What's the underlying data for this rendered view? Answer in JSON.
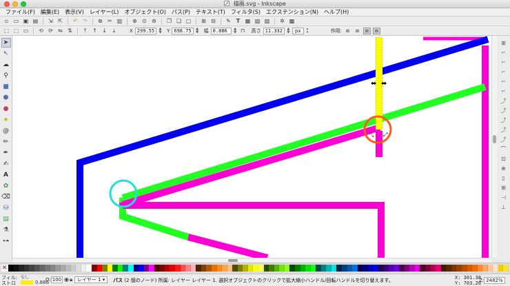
{
  "window": {
    "title": "描画.svg - Inkscape"
  },
  "menu": [
    {
      "label": "ファイル(F)"
    },
    {
      "label": "編集(E)"
    },
    {
      "label": "表示(V)"
    },
    {
      "label": "レイヤー(L)"
    },
    {
      "label": "オブジェクト(O)"
    },
    {
      "label": "パス(P)"
    },
    {
      "label": "テキスト(T)"
    },
    {
      "label": "フィルタ(S)"
    },
    {
      "label": "エクステンション(N)"
    },
    {
      "label": "ヘルプ(H)"
    }
  ],
  "controls": {
    "x_label": "X",
    "x_value": "299.55",
    "y_label": "Y",
    "y_value": "698.75",
    "w_label": "幅",
    "w_value": "0.886",
    "h_label": "高さ",
    "h_value": "11.332",
    "unit": "px",
    "affect_label": "作用:"
  },
  "status": {
    "fill_label": "フィル:",
    "stroke_label": "ストローク:",
    "fill_value": "なし",
    "stroke_width": "0.886",
    "opacity_label": "O:",
    "opacity_value": "100",
    "layer": "レイヤー 1",
    "message_prefix": "パス",
    "message": "(2 個のノード) 所属: レイヤー レイヤー 1. 選択オブジェクトのクリックで拡大縮小ハンドル/回転ハンドルを切り替えます。",
    "x_label": "X:",
    "x_value": "301.38",
    "y_label": "Y:",
    "y_value": "703.20",
    "zoom_label": "Z:",
    "zoom_value": "2482%"
  },
  "colors": {
    "blue": "#0000ee",
    "green": "#22ff22",
    "magenta": "#ff00d4",
    "yellow": "#ffff00",
    "cyan_circle": "#22dddd",
    "orange_circle": "#ff5a1a"
  },
  "palette": [
    "#000000",
    "#111111",
    "#222222",
    "#333333",
    "#444444",
    "#555555",
    "#666666",
    "#777777",
    "#888888",
    "#999999",
    "#aaaaaa",
    "#bbbbbb",
    "#cccccc",
    "#dddddd",
    "#eeeeee",
    "#ffffff",
    "#800000",
    "#ff0000",
    "#808000",
    "#ffff00",
    "#008000",
    "#00ff00",
    "#008080",
    "#00ffff",
    "#000080",
    "#0000ff",
    "#800080",
    "#ff00ff",
    "#4d0000",
    "#800000",
    "#b30000",
    "#e60000",
    "#ff1a1a",
    "#ff4d4d",
    "#ff8080",
    "#ffb3b3",
    "#4d2600",
    "#803f00",
    "#b35900",
    "#e67300",
    "#ff8c1a",
    "#ffa64d",
    "#ffc080",
    "#4d4d00",
    "#808000",
    "#b3b300",
    "#e6e600",
    "#ffff1a",
    "#ffff4d",
    "#264d00",
    "#3f8000",
    "#59b300",
    "#73e600",
    "#8cff1a",
    "#004d00",
    "#008000",
    "#00b300",
    "#00e600",
    "#1aff1a",
    "#004d4d",
    "#008080",
    "#00b3b3",
    "#00e6e6",
    "#00264d",
    "#003f80",
    "#0059b3",
    "#0073e6",
    "#00004d",
    "#000080",
    "#0000b3",
    "#0000e6",
    "#26004d",
    "#3f0080",
    "#5900b3",
    "#7300e6",
    "#4d004d",
    "#800080",
    "#b300b3",
    "#e600e6",
    "#4d0026",
    "#80003f",
    "#b30059",
    "#e60073",
    "#3d1a00",
    "#5c2800",
    "#7a3500",
    "#994300",
    "#b85000",
    "#d65e00",
    "#f56b00",
    "#ff8a33",
    "#ffa866",
    "#ffc699",
    "#ffe3cc",
    "#f0d000",
    "#ffdf33"
  ]
}
